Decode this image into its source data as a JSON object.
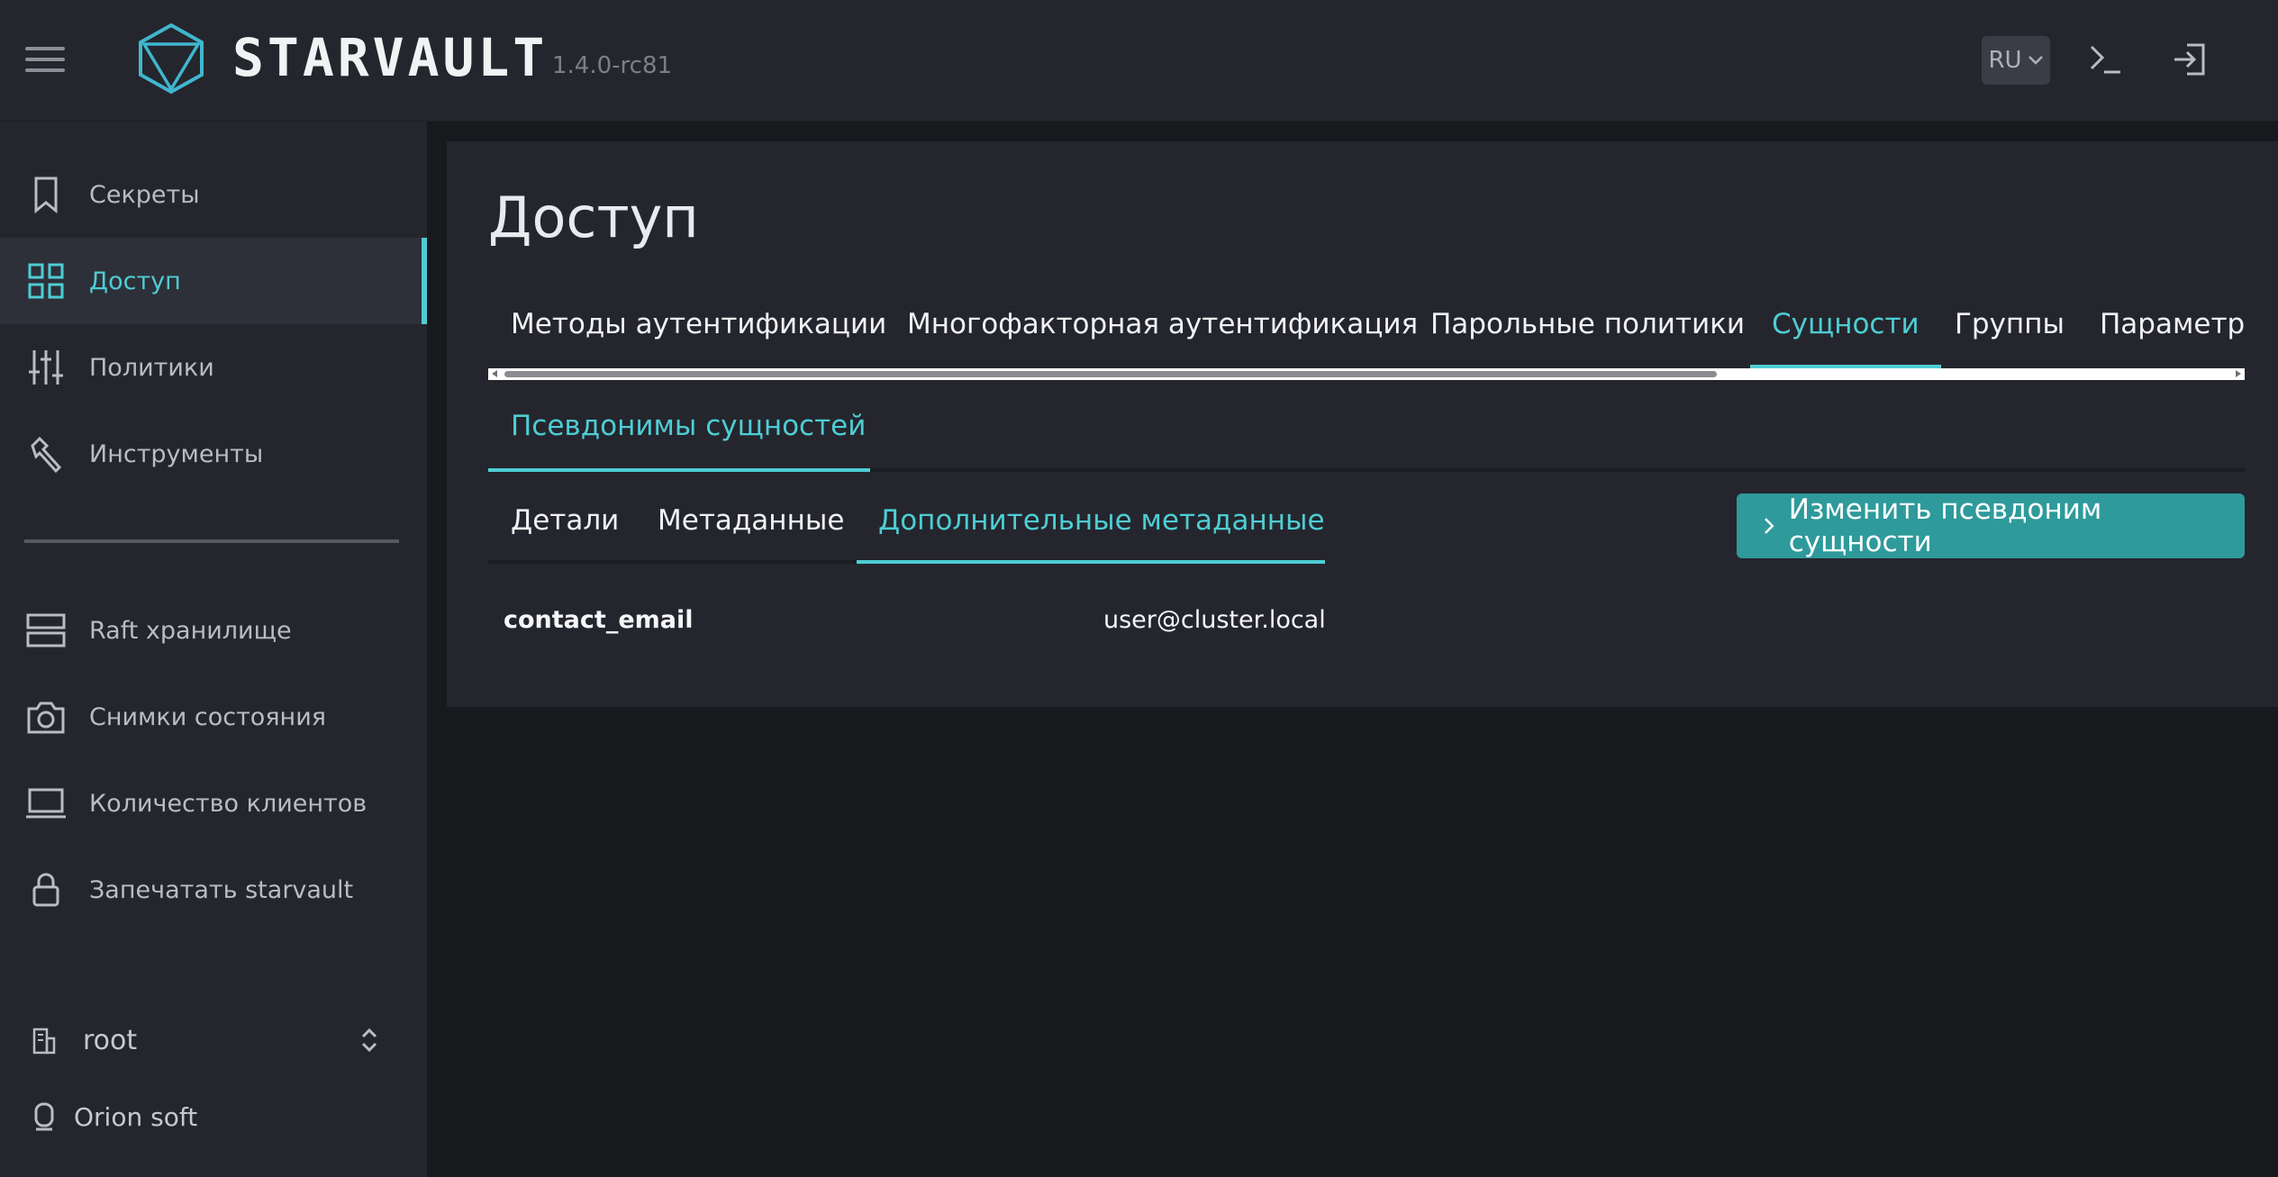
{
  "header": {
    "brand": "STARVAULT",
    "version": "1.4.0-rc81",
    "language": "RU",
    "icons": [
      "menu-icon",
      "starvault-logo-icon",
      "chevron-down-icon",
      "terminal-icon",
      "logout-icon"
    ]
  },
  "sidebar": {
    "items": [
      {
        "label": "Секреты",
        "icon": "bookmark-icon",
        "active": false
      },
      {
        "label": "Доступ",
        "icon": "grid-icon",
        "active": true
      },
      {
        "label": "Политики",
        "icon": "sliders-icon",
        "active": false
      },
      {
        "label": "Инструменты",
        "icon": "tools-icon",
        "active": false
      },
      {
        "label": "Raft хранилище",
        "icon": "server-icon",
        "active": false
      },
      {
        "label": "Снимки состояния",
        "icon": "camera-icon",
        "active": false
      },
      {
        "label": "Количество клиентов",
        "icon": "laptop-icon",
        "active": false
      },
      {
        "label": "Запечатать starvault",
        "icon": "lock-icon",
        "active": false
      }
    ],
    "namespace": "root",
    "organization": "Orion soft"
  },
  "main": {
    "title": "Доступ",
    "tabs": [
      {
        "label": "Методы аутентификации",
        "active": false
      },
      {
        "label": "Многофакторная аутентификация",
        "active": false
      },
      {
        "label": "Парольные политики",
        "active": false
      },
      {
        "label": "Сущности",
        "active": true
      },
      {
        "label": "Группы",
        "active": false
      },
      {
        "label": "Параметры",
        "active": false
      }
    ],
    "subtab": "Псевдонимы сущностей",
    "detail_tabs": [
      {
        "label": "Детали",
        "active": false
      },
      {
        "label": "Метаданные",
        "active": false
      },
      {
        "label": "Дополнительные метаданные",
        "active": true
      }
    ],
    "edit_button": "Изменить псевдоним сущности",
    "metadata": [
      {
        "key": "contact_email",
        "value": "user@cluster.local"
      }
    ]
  },
  "colors": {
    "accent": "#4ecdd4",
    "button": "#2f9a9b",
    "panel": "#25262d",
    "background": "#18191d"
  }
}
